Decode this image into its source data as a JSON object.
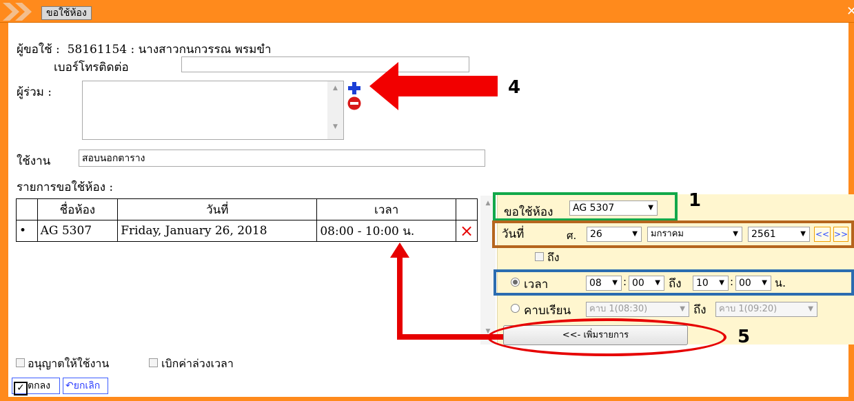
{
  "window": {
    "title": "ขอใช้ห้อง",
    "close_icon": "close-icon"
  },
  "form": {
    "requester_label": "ผู้ขอใช้",
    "requester_value": "58161154 : นางสาวกนกวรรณ พรมขำ",
    "phone_label": "เบอร์โทรติดต่อ",
    "phone_value": "",
    "participants_label": "ผู้ร่วม :",
    "usage_label": "ใช้งาน",
    "usage_value": "สอบนอกตาราง",
    "list_label": "รายการขอใช้ห้อง :"
  },
  "table": {
    "headers": [
      "",
      "ชื่อห้อง",
      "วันที่",
      "เวลา",
      ""
    ],
    "rows": [
      {
        "bullet": "•",
        "room": "AG 5307",
        "date": "Friday, January 26, 2018",
        "time": "08:00 - 10:00 น.",
        "delete": "×"
      }
    ]
  },
  "panel": {
    "room_label": "ขอใช้ห้อง",
    "room_value": "AG 5307",
    "date_label": "วันที่",
    "weekday": "ศ.",
    "day": "26",
    "month": "มกราคม",
    "year": "2561",
    "prev_label": "<<",
    "next_label": ">>",
    "until_checkbox": "ถึง",
    "time_radio": "เวลา",
    "start_hour": "08",
    "start_min": "00",
    "to_label": "ถึง",
    "end_hour": "10",
    "end_min": "00",
    "unit": "น.",
    "period_radio": "คาบเรียน",
    "period_start": "คาบ 1(08:30)",
    "period_end": "คาบ 1(09:20)",
    "add_button": "<<- เพิ่มรายการ"
  },
  "footer": {
    "allow_label": "อนุญาตให้ใช้งาน",
    "overtime_label": "เบิกค่าล่วงเวลา",
    "ok_label": "ตกลง",
    "cancel_label": "ยกเลิก"
  },
  "annotations": {
    "label_1": "1",
    "label_4": "4",
    "label_5": "5",
    "color_green": "#12a84a",
    "color_brown": "#b5651d",
    "color_blue": "#2b6cb0",
    "color_red": "#e60000"
  }
}
